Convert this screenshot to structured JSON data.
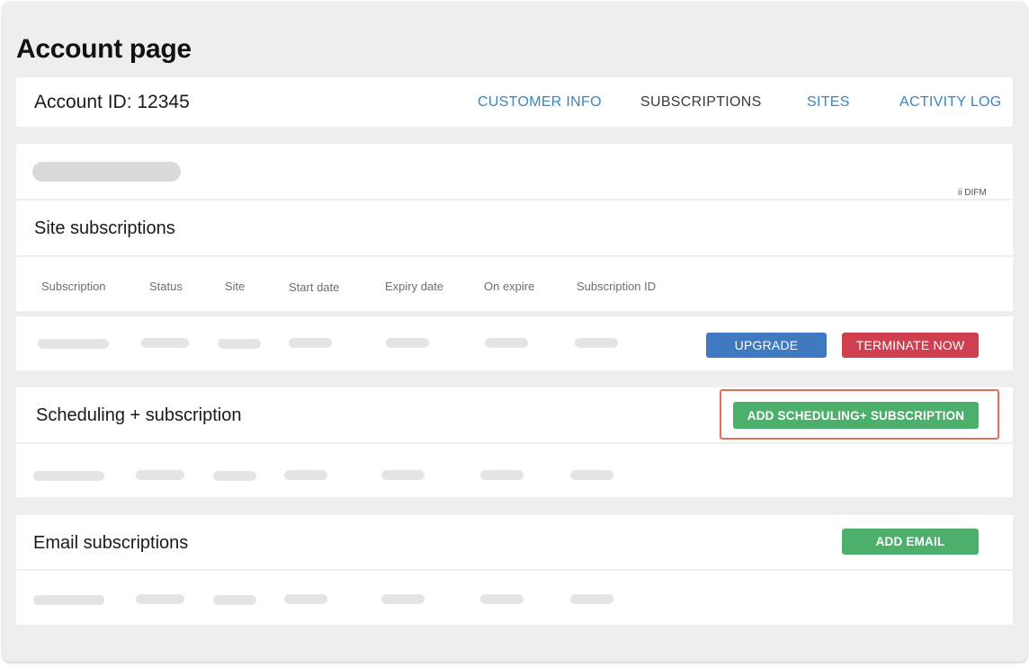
{
  "page": {
    "title": "Account page"
  },
  "header": {
    "account_label": "Account ID: 12345",
    "nav": [
      {
        "label": "CUSTOMER INFO",
        "active": false
      },
      {
        "label": "SUBSCRIPTIONS",
        "active": true
      },
      {
        "label": "SITES",
        "active": false
      },
      {
        "label": "ACTIVITY LOG",
        "active": false
      }
    ]
  },
  "info_card": {
    "tag": "ii DIFM"
  },
  "site_subscriptions": {
    "title": "Site subscriptions",
    "columns": [
      "Subscription",
      "Status",
      "Site",
      "Start date",
      "Expiry date",
      "On expire",
      "Subscription ID"
    ],
    "actions": {
      "upgrade": "UPGRADE",
      "terminate": "TERMINATE NOW"
    }
  },
  "scheduling": {
    "title": "Scheduling + subscription",
    "add_button": "ADD SCHEDULING+ SUBSCRIPTION"
  },
  "email": {
    "title": "Email subscriptions",
    "add_button": "ADD EMAIL"
  },
  "colors": {
    "link": "#3a86c2",
    "upgrade": "#3f79c0",
    "terminate": "#cf3f4f",
    "add": "#4caf6c",
    "highlight": "#e0705a"
  }
}
